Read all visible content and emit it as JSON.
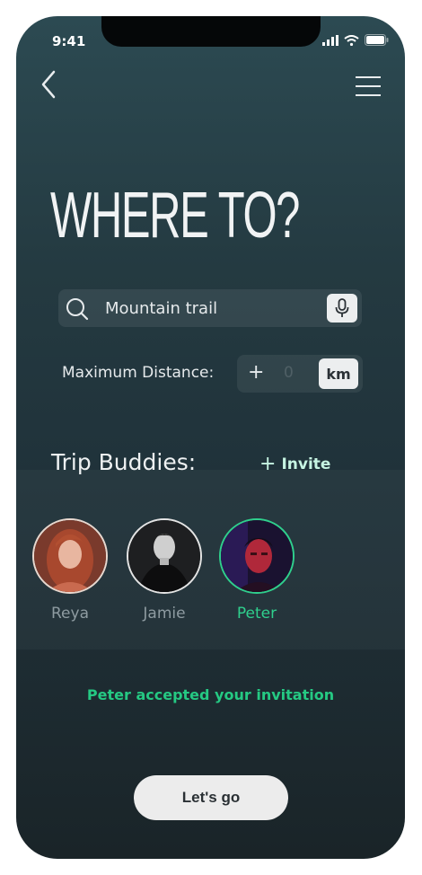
{
  "status_bar": {
    "time": "9:41"
  },
  "header": {
    "title": "WHERE TO?"
  },
  "search": {
    "value": "Mountain trail"
  },
  "distance": {
    "label": "Maximum Distance:",
    "plus": "+",
    "value": "0",
    "unit": "km"
  },
  "buddies": {
    "heading": "Trip Buddies:",
    "invite_plus": "+",
    "invite_label": "Invite",
    "list": [
      {
        "name": "Reya"
      },
      {
        "name": "Jamie"
      },
      {
        "name": "Peter"
      }
    ]
  },
  "notification": "Peter accepted your invitation",
  "cta": {
    "label": "Let's go"
  },
  "colors": {
    "accent": "#2fcf8d",
    "invite": "#c6f4e2",
    "background": "#243a41"
  }
}
